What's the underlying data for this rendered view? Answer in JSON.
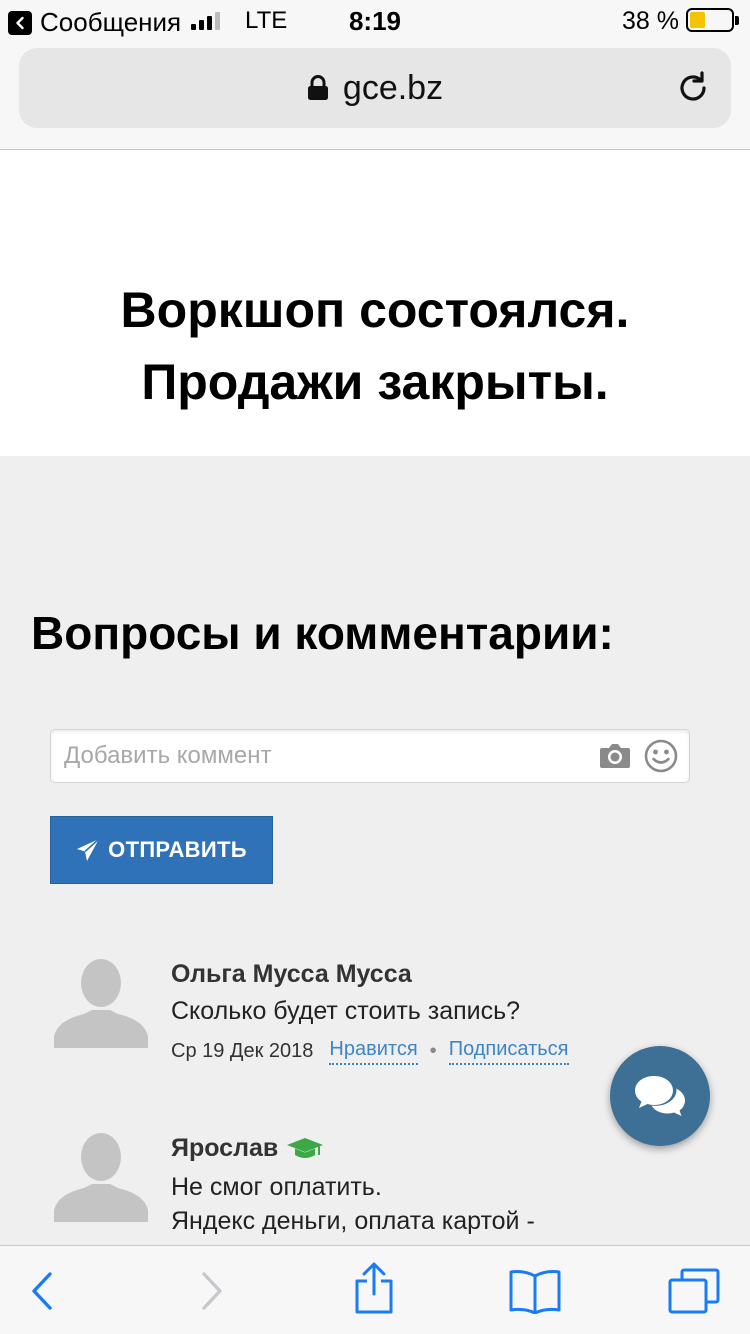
{
  "status_bar": {
    "back_app": "Сообщения",
    "carrier": "LTE",
    "time": "8:19",
    "battery": "38 %",
    "battery_level": 0.38
  },
  "browser": {
    "url": "gce.bz",
    "toolbar_icons": [
      "back-icon",
      "forward-icon",
      "share-icon",
      "bookmarks-icon",
      "tabs-icon"
    ]
  },
  "hero": {
    "line1": "Воркшоп состоялся.",
    "line2": "Продажи закрыты."
  },
  "comments_section": {
    "title": "Вопросы и комментарии:",
    "input_placeholder": "Добавить коммент",
    "send_label": "ОТПРАВИТЬ",
    "comments": [
      {
        "author": "Ольга Мусса Мусса",
        "text": "Сколько будет стоить запись?",
        "date": "Ср 19 Дек 2018",
        "like": "Нравится",
        "separator": "•",
        "subscribe": "Подписаться"
      },
      {
        "author": "Ярослав",
        "text_line1": "Не смог оплатить.",
        "text_line2": "Яндекс деньги, оплата картой -"
      }
    ]
  },
  "colors": {
    "accent": "#2f72b7",
    "link": "#3d86c6",
    "fab": "#3e6f95",
    "badge_green": "#3aa845",
    "ios_blue": "#1a7cf5"
  }
}
